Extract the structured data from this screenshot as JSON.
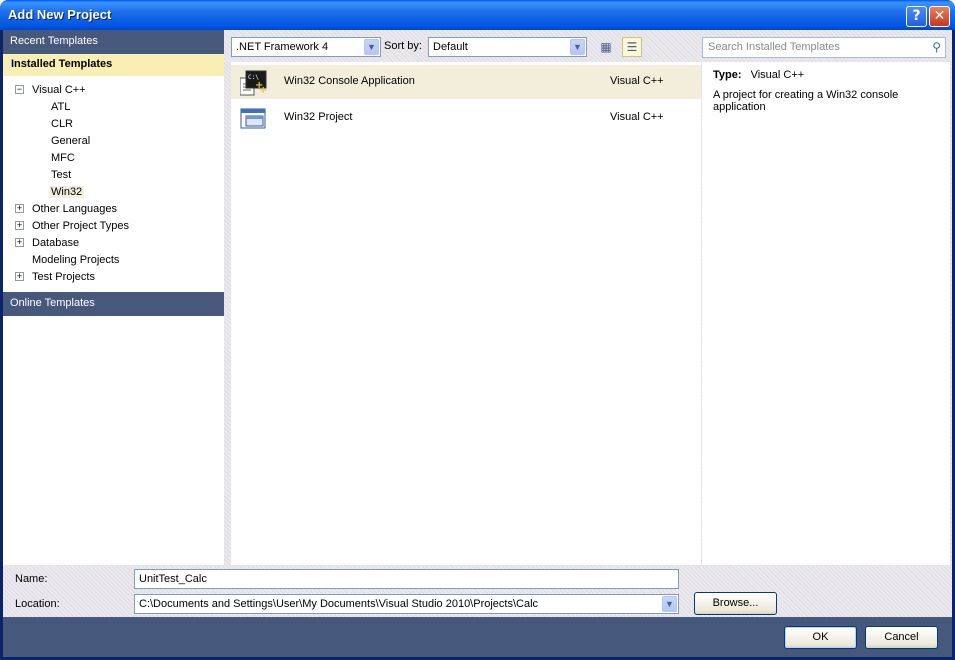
{
  "window": {
    "title": "Add New Project"
  },
  "titlebar": {
    "help_label": "?",
    "close_label": "✕"
  },
  "left": {
    "recent_label": "Recent Templates",
    "installed_label": "Installed Templates",
    "online_label": "Online Templates",
    "tree": [
      {
        "label": "Visual C++",
        "expander": "−",
        "level": 0,
        "selected": false
      },
      {
        "label": "ATL",
        "expander": "",
        "level": 1,
        "selected": false
      },
      {
        "label": "CLR",
        "expander": "",
        "level": 1,
        "selected": false
      },
      {
        "label": "General",
        "expander": "",
        "level": 1,
        "selected": false
      },
      {
        "label": "MFC",
        "expander": "",
        "level": 1,
        "selected": false
      },
      {
        "label": "Test",
        "expander": "",
        "level": 1,
        "selected": false
      },
      {
        "label": "Win32",
        "expander": "",
        "level": 1,
        "selected": true
      },
      {
        "label": "Other Languages",
        "expander": "+",
        "level": 0,
        "selected": false
      },
      {
        "label": "Other Project Types",
        "expander": "+",
        "level": 0,
        "selected": false
      },
      {
        "label": "Database",
        "expander": "+",
        "level": 0,
        "selected": false
      },
      {
        "label": "Modeling Projects",
        "expander": "",
        "level": 0,
        "selected": false
      },
      {
        "label": "Test Projects",
        "expander": "+",
        "level": 0,
        "selected": false
      }
    ]
  },
  "toolbar": {
    "framework_value": ".NET Framework 4",
    "sortby_label": "Sort by:",
    "sortby_value": "Default",
    "search_placeholder": "Search Installed Templates"
  },
  "templates": [
    {
      "name": "Win32 Console Application",
      "language": "Visual C++",
      "icon": "console-app-icon",
      "selected": true
    },
    {
      "name": "Win32 Project",
      "language": "Visual C++",
      "icon": "window-app-icon",
      "selected": false
    }
  ],
  "details": {
    "type_label": "Type:",
    "type_value": "Visual C++",
    "description": "A project for creating a Win32 console application"
  },
  "form": {
    "name_label": "Name:",
    "name_value": "UnitTest_Calc",
    "location_label": "Location:",
    "location_value": "C:\\Documents and Settings\\User\\My Documents\\Visual Studio 2010\\Projects\\Calc",
    "browse_label": "Browse..."
  },
  "buttons": {
    "ok_label": "OK",
    "cancel_label": "Cancel"
  }
}
